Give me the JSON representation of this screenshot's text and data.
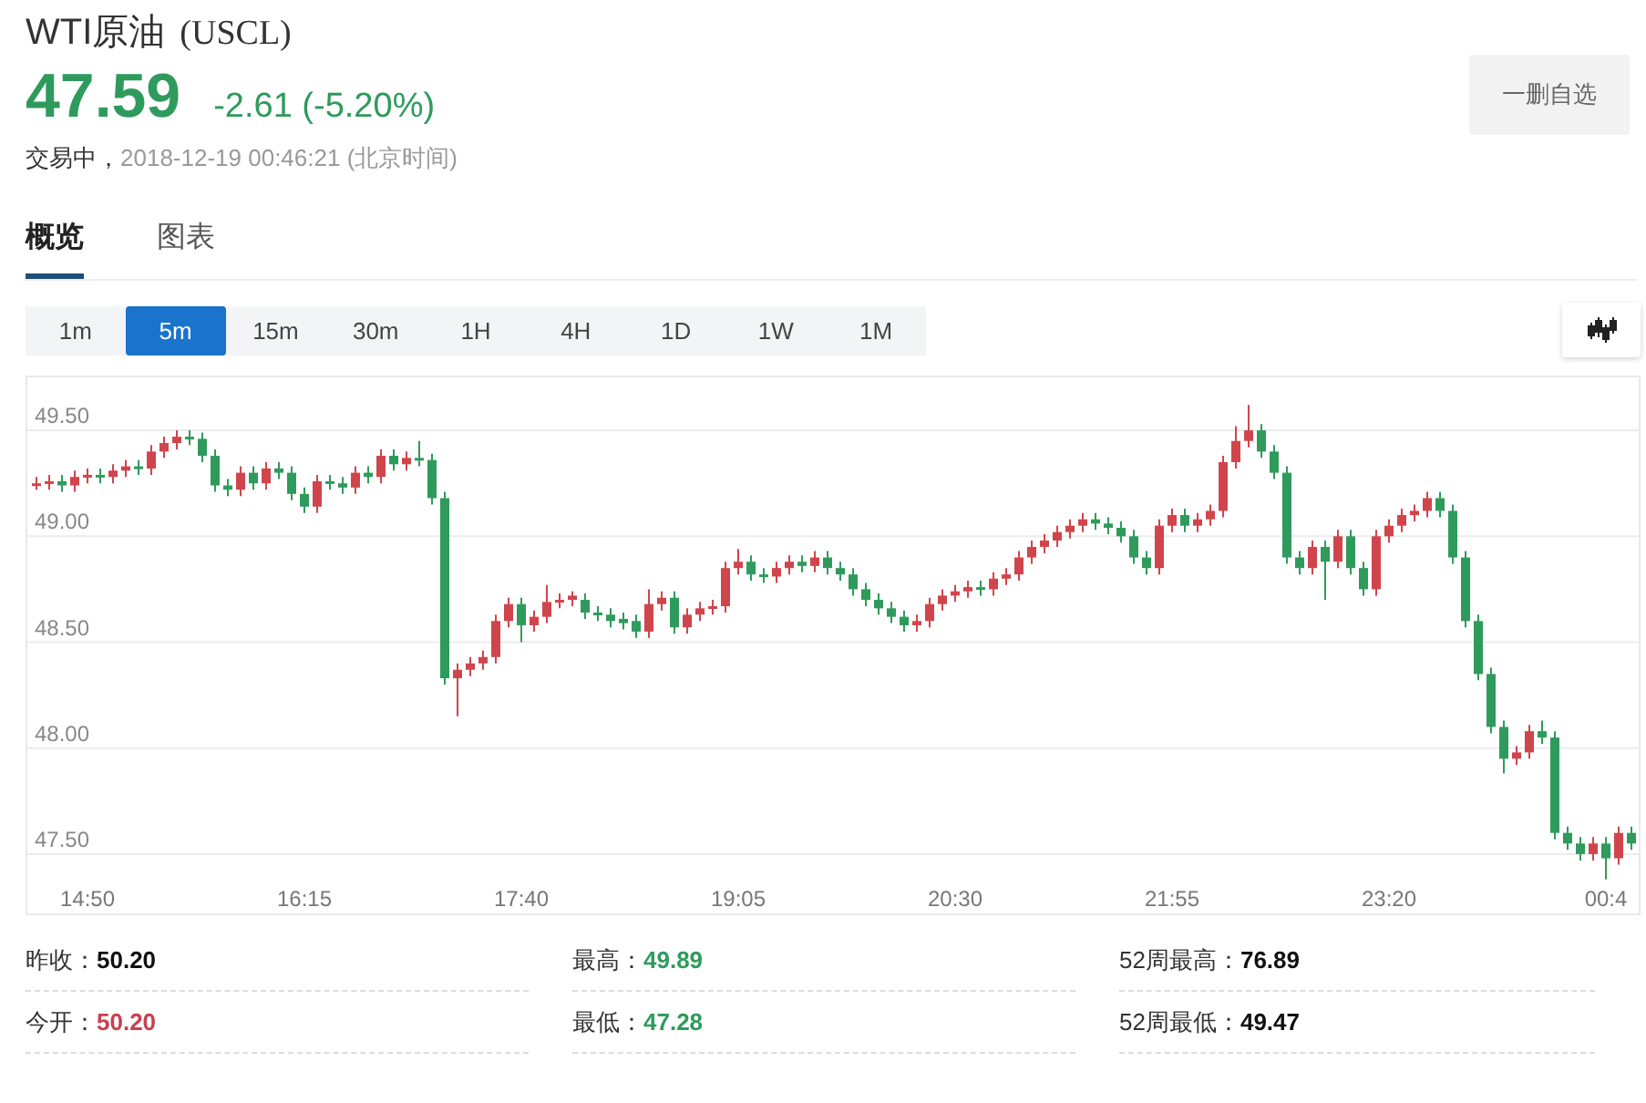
{
  "header": {
    "name": "WTI原油",
    "code": "(USCL)",
    "price": "47.59",
    "change": "-2.61 (-5.20%)",
    "status": "交易中，",
    "time": "2018-12-19 00:46:21 (北京时间)",
    "watch_button": "一删自选"
  },
  "tabs": [
    {
      "label": "概览",
      "selected": true
    },
    {
      "label": "图表",
      "selected": false
    }
  ],
  "intervals": [
    {
      "label": "1m",
      "selected": false
    },
    {
      "label": "5m",
      "selected": true
    },
    {
      "label": "15m",
      "selected": false
    },
    {
      "label": "30m",
      "selected": false
    },
    {
      "label": "1H",
      "selected": false
    },
    {
      "label": "4H",
      "selected": false
    },
    {
      "label": "1D",
      "selected": false
    },
    {
      "label": "1W",
      "selected": false
    },
    {
      "label": "1M",
      "selected": false
    }
  ],
  "chart_data": {
    "type": "candlestick",
    "grid": true,
    "categories": [
      null,
      null,
      null,
      null,
      "14:50",
      null,
      null,
      null,
      null,
      null,
      null,
      null,
      null,
      null,
      null,
      null,
      null,
      null,
      null,
      null,
      null,
      "16:15",
      null,
      null,
      null,
      null,
      null,
      null,
      null,
      null,
      null,
      null,
      null,
      null,
      null,
      null,
      null,
      null,
      "17:40",
      null,
      null,
      null,
      null,
      null,
      null,
      null,
      null,
      null,
      null,
      null,
      null,
      null,
      null,
      null,
      null,
      "19:05",
      null,
      null,
      null,
      null,
      null,
      null,
      null,
      null,
      null,
      null,
      null,
      null,
      null,
      null,
      null,
      null,
      "20:30",
      null,
      null,
      null,
      null,
      null,
      null,
      null,
      null,
      null,
      null,
      null,
      null,
      null,
      null,
      null,
      null,
      "21:55",
      null,
      null,
      null,
      null,
      null,
      null,
      null,
      null,
      null,
      null,
      null,
      null,
      null,
      null,
      null,
      null,
      "23:20",
      null,
      null,
      null,
      null,
      null,
      null,
      null,
      null,
      null,
      null,
      null,
      null,
      null,
      null,
      null,
      null,
      "00:4",
      null,
      null
    ],
    "ohlc": [
      [
        49.25,
        49.28,
        49.22,
        49.25
      ],
      [
        49.25,
        49.29,
        49.22,
        49.26
      ],
      [
        49.26,
        49.29,
        49.21,
        49.24
      ],
      [
        49.24,
        49.31,
        49.21,
        49.28
      ],
      [
        49.28,
        49.32,
        49.25,
        49.29
      ],
      [
        49.29,
        49.32,
        49.25,
        49.28
      ],
      [
        49.28,
        49.34,
        49.25,
        49.31
      ],
      [
        49.31,
        49.36,
        49.28,
        49.33
      ],
      [
        49.33,
        49.36,
        49.29,
        49.32
      ],
      [
        49.32,
        49.43,
        49.29,
        49.4
      ],
      [
        49.4,
        49.47,
        49.37,
        49.44
      ],
      [
        49.44,
        49.5,
        49.41,
        49.47
      ],
      [
        49.47,
        49.5,
        49.43,
        49.46
      ],
      [
        49.46,
        49.49,
        49.35,
        49.38
      ],
      [
        49.38,
        49.41,
        49.21,
        49.24
      ],
      [
        49.24,
        49.27,
        49.19,
        49.22
      ],
      [
        49.22,
        49.33,
        49.19,
        49.3
      ],
      [
        49.3,
        49.33,
        49.22,
        49.25
      ],
      [
        49.25,
        49.35,
        49.22,
        49.32
      ],
      [
        49.32,
        49.35,
        49.27,
        49.3
      ],
      [
        49.3,
        49.33,
        49.17,
        49.2
      ],
      [
        49.2,
        49.23,
        49.11,
        49.14
      ],
      [
        49.14,
        49.29,
        49.11,
        49.26
      ],
      [
        49.26,
        49.29,
        49.22,
        49.25
      ],
      [
        49.25,
        49.28,
        49.2,
        49.23
      ],
      [
        49.23,
        49.33,
        49.2,
        49.3
      ],
      [
        49.3,
        49.33,
        49.25,
        49.28
      ],
      [
        49.28,
        49.41,
        49.25,
        49.38
      ],
      [
        49.38,
        49.41,
        49.31,
        49.34
      ],
      [
        49.34,
        49.4,
        49.31,
        49.37
      ],
      [
        49.37,
        49.45,
        49.33,
        49.36
      ],
      [
        49.36,
        49.39,
        49.15,
        49.18
      ],
      [
        49.18,
        49.21,
        48.3,
        48.33
      ],
      [
        48.33,
        48.4,
        48.15,
        48.37
      ],
      [
        48.37,
        48.43,
        48.34,
        48.4
      ],
      [
        48.4,
        48.46,
        48.37,
        48.43
      ],
      [
        48.43,
        48.63,
        48.4,
        48.6
      ],
      [
        48.6,
        48.71,
        48.57,
        48.68
      ],
      [
        48.68,
        48.71,
        48.5,
        48.58
      ],
      [
        48.58,
        48.65,
        48.55,
        48.62
      ],
      [
        48.62,
        48.77,
        48.59,
        48.69
      ],
      [
        48.69,
        48.73,
        48.66,
        48.7
      ],
      [
        48.7,
        48.74,
        48.67,
        48.72
      ],
      [
        48.7,
        48.73,
        48.61,
        48.64
      ],
      [
        48.64,
        48.67,
        48.6,
        48.63
      ],
      [
        48.63,
        48.66,
        48.57,
        48.6
      ],
      [
        48.61,
        48.64,
        48.56,
        48.59
      ],
      [
        48.6,
        48.63,
        48.52,
        48.55
      ],
      [
        48.55,
        48.75,
        48.52,
        48.68
      ],
      [
        48.68,
        48.74,
        48.65,
        48.71
      ],
      [
        48.71,
        48.74,
        48.54,
        48.57
      ],
      [
        48.57,
        48.66,
        48.54,
        48.63
      ],
      [
        48.63,
        48.69,
        48.6,
        48.66
      ],
      [
        48.66,
        48.7,
        48.63,
        48.67
      ],
      [
        48.67,
        48.88,
        48.64,
        48.85
      ],
      [
        48.85,
        48.94,
        48.82,
        48.88
      ],
      [
        48.88,
        48.91,
        48.79,
        48.82
      ],
      [
        48.82,
        48.85,
        48.78,
        48.81
      ],
      [
        48.81,
        48.88,
        48.78,
        48.85
      ],
      [
        48.85,
        48.91,
        48.82,
        48.88
      ],
      [
        48.88,
        48.91,
        48.83,
        48.86
      ],
      [
        48.86,
        48.93,
        48.83,
        48.9
      ],
      [
        48.9,
        48.93,
        48.82,
        48.85
      ],
      [
        48.85,
        48.88,
        48.79,
        48.82
      ],
      [
        48.82,
        48.85,
        48.72,
        48.75
      ],
      [
        48.75,
        48.78,
        48.67,
        48.7
      ],
      [
        48.7,
        48.73,
        48.63,
        48.66
      ],
      [
        48.66,
        48.69,
        48.59,
        48.62
      ],
      [
        48.62,
        48.65,
        48.55,
        48.58
      ],
      [
        48.58,
        48.63,
        48.55,
        48.6
      ],
      [
        48.6,
        48.71,
        48.57,
        48.68
      ],
      [
        48.68,
        48.75,
        48.65,
        48.72
      ],
      [
        48.72,
        48.77,
        48.69,
        48.74
      ],
      [
        48.74,
        48.79,
        48.71,
        48.76
      ],
      [
        48.76,
        48.79,
        48.72,
        48.75
      ],
      [
        48.75,
        48.83,
        48.72,
        48.8
      ],
      [
        48.8,
        48.85,
        48.77,
        48.82
      ],
      [
        48.82,
        48.93,
        48.79,
        48.9
      ],
      [
        48.9,
        48.98,
        48.87,
        48.95
      ],
      [
        48.95,
        49.01,
        48.92,
        48.98
      ],
      [
        48.98,
        49.05,
        48.95,
        49.02
      ],
      [
        49.02,
        49.08,
        48.99,
        49.05
      ],
      [
        49.05,
        49.11,
        49.02,
        49.08
      ],
      [
        49.08,
        49.11,
        49.03,
        49.06
      ],
      [
        49.06,
        49.09,
        49.01,
        49.04
      ],
      [
        49.04,
        49.07,
        48.97,
        49.0
      ],
      [
        49.0,
        49.03,
        48.87,
        48.9
      ],
      [
        48.9,
        48.93,
        48.82,
        48.85
      ],
      [
        48.85,
        49.08,
        48.82,
        49.05
      ],
      [
        49.05,
        49.13,
        49.02,
        49.1
      ],
      [
        49.1,
        49.13,
        49.02,
        49.05
      ],
      [
        49.05,
        49.11,
        49.02,
        49.08
      ],
      [
        49.08,
        49.15,
        49.05,
        49.12
      ],
      [
        49.12,
        49.38,
        49.09,
        49.35
      ],
      [
        49.35,
        49.52,
        49.32,
        49.45
      ],
      [
        49.45,
        49.62,
        49.42,
        49.5
      ],
      [
        49.5,
        49.53,
        49.37,
        49.4
      ],
      [
        49.4,
        49.43,
        49.27,
        49.3
      ],
      [
        49.3,
        49.33,
        48.87,
        48.9
      ],
      [
        48.9,
        48.93,
        48.82,
        48.85
      ],
      [
        48.85,
        48.98,
        48.82,
        48.95
      ],
      [
        48.95,
        48.98,
        48.7,
        48.88
      ],
      [
        48.88,
        49.03,
        48.85,
        49.0
      ],
      [
        49.0,
        49.03,
        48.82,
        48.85
      ],
      [
        48.85,
        48.88,
        48.72,
        48.75
      ],
      [
        48.75,
        49.03,
        48.72,
        49.0
      ],
      [
        49.0,
        49.08,
        48.97,
        49.05
      ],
      [
        49.05,
        49.13,
        49.02,
        49.1
      ],
      [
        49.1,
        49.15,
        49.07,
        49.12
      ],
      [
        49.12,
        49.21,
        49.09,
        49.18
      ],
      [
        49.18,
        49.21,
        49.09,
        49.12
      ],
      [
        49.12,
        49.15,
        48.87,
        48.9
      ],
      [
        48.9,
        48.93,
        48.57,
        48.6
      ],
      [
        48.6,
        48.63,
        48.32,
        48.35
      ],
      [
        48.35,
        48.38,
        48.07,
        48.1
      ],
      [
        48.1,
        48.13,
        47.88,
        47.95
      ],
      [
        47.95,
        48.01,
        47.92,
        47.98
      ],
      [
        47.98,
        48.11,
        47.95,
        48.08
      ],
      [
        48.08,
        48.13,
        48.02,
        48.05
      ],
      [
        48.05,
        48.08,
        47.57,
        47.6
      ],
      [
        47.6,
        47.63,
        47.52,
        47.55
      ],
      [
        47.55,
        47.58,
        47.47,
        47.5
      ],
      [
        47.5,
        47.58,
        47.47,
        47.55
      ],
      [
        47.55,
        47.58,
        47.38,
        47.48
      ],
      [
        47.48,
        47.63,
        47.45,
        47.6
      ],
      [
        47.6,
        47.63,
        47.52,
        47.55
      ]
    ],
    "ylim": [
      47.22,
      49.75
    ],
    "yticks": [
      {
        "value": 47.5,
        "label": "47.50"
      },
      {
        "value": 48,
        "label": "48.00"
      },
      {
        "value": 48.5,
        "label": "48.50"
      },
      {
        "value": 49,
        "label": "49.00"
      },
      {
        "value": 49.5,
        "label": "49.50"
      }
    ]
  },
  "stats": [
    {
      "label": "昨收：",
      "value": "50.20",
      "color": "#111111"
    },
    {
      "label": "最高：",
      "value": "49.89",
      "color": "#2e9b5c"
    },
    {
      "label": "52周最高：",
      "value": "76.89",
      "color": "#111111"
    },
    {
      "label": "今开：",
      "value": "50.20",
      "color": "#c8414f"
    },
    {
      "label": "最低：",
      "value": "47.28",
      "color": "#2e9b5c"
    },
    {
      "label": "52周最低：",
      "value": "49.47",
      "color": "#111111"
    }
  ]
}
